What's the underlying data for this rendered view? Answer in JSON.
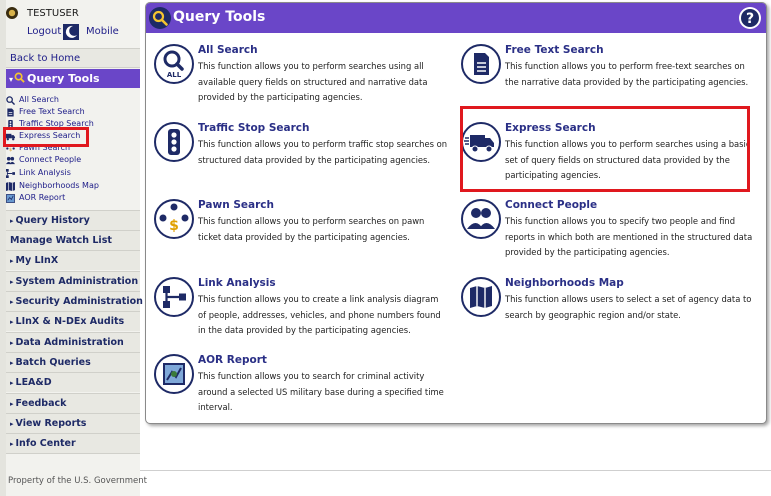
{
  "user": {
    "name": "TESTUSER",
    "logout_label": "Logout",
    "mobile_label": "Mobile"
  },
  "sidebar": {
    "back_home": "Back to Home",
    "active_section": "Query Tools",
    "sub_items": [
      {
        "label": "All Search",
        "icon": "magnifier-icon"
      },
      {
        "label": "Free Text Search",
        "icon": "document-icon"
      },
      {
        "label": "Traffic Stop Search",
        "icon": "traffic-light-icon"
      },
      {
        "label": "Express Search",
        "icon": "truck-icon"
      },
      {
        "label": "Pawn Search",
        "icon": "pawn-icon"
      },
      {
        "label": "Connect People",
        "icon": "people-icon"
      },
      {
        "label": "Link Analysis",
        "icon": "link-icon"
      },
      {
        "label": "Neighborhoods Map",
        "icon": "map-icon"
      },
      {
        "label": "AOR Report",
        "icon": "report-icon"
      }
    ],
    "sections": [
      "Query History",
      "Manage Watch List",
      "My LInX",
      "System Administration",
      "Security Administration",
      "LInX & N-DEx Audits",
      "Data Administration",
      "Batch Queries",
      "LEA&D",
      "Feedback",
      "View Reports",
      "Info Center"
    ]
  },
  "panel": {
    "title": "Query Tools",
    "tools": [
      {
        "title": "All Search",
        "icon": "all-search-icon",
        "description": "This function allows you to perform searches using all available query fields on structured and narrative data provided by the participating agencies."
      },
      {
        "title": "Free Text Search",
        "icon": "document-icon",
        "description": "This function allows you to perform free-text searches on the narrative data provided by the participating agencies."
      },
      {
        "title": "Traffic Stop Search",
        "icon": "traffic-light-icon",
        "description": "This function allows you to perform traffic stop searches on structured data provided by the participating agencies."
      },
      {
        "title": "Express Search",
        "icon": "truck-icon",
        "description": "This function allows you to perform searches using a basic set of query fields on structured data provided by the participating agencies."
      },
      {
        "title": "Pawn Search",
        "icon": "pawn-icon",
        "description": "This function allows you to perform searches on pawn ticket data provided by the participating agencies."
      },
      {
        "title": "Connect People",
        "icon": "people-icon",
        "description": "This function allows you to specify two people and find reports in which both are mentioned in the structured data provided by the participating agencies."
      },
      {
        "title": "Link Analysis",
        "icon": "link-icon",
        "description": "This function allows you to create a link analysis diagram of people, addresses, vehicles, and phone numbers found in the data provided by the participating agencies."
      },
      {
        "title": "Neighborhoods Map",
        "icon": "map-icon",
        "description": "This function allows users to select a set of agency data to search by geographic region and/or state."
      },
      {
        "title": "AOR Report",
        "icon": "report-icon",
        "description": "This function allows you to search for criminal activity around a selected US military base during a specified time interval."
      }
    ]
  },
  "footer": {
    "text": "Property of the U.S. Government"
  },
  "colors": {
    "accent": "#6a46c8",
    "icon_navy": "#1e2a66",
    "highlight": "#e0181e",
    "link": "#21208a"
  }
}
